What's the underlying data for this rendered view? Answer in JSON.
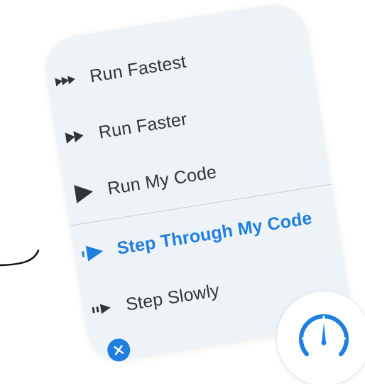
{
  "menu": {
    "items": [
      {
        "label": "Run Fastest",
        "icon": "triple-play-icon"
      },
      {
        "label": "Run Faster",
        "icon": "double-play-icon"
      },
      {
        "label": "Run My Code",
        "icon": "play-icon"
      },
      {
        "label": "Step Through My Code",
        "icon": "step-through-icon",
        "selected": true
      },
      {
        "label": "Step Slowly",
        "icon": "step-slowly-icon"
      }
    ],
    "close_icon": "close-icon"
  },
  "speed_control": {
    "icon": "speedometer-icon"
  },
  "colors": {
    "accent": "#1f7fe0",
    "text": "#333338",
    "panel": "#eef3f7"
  }
}
